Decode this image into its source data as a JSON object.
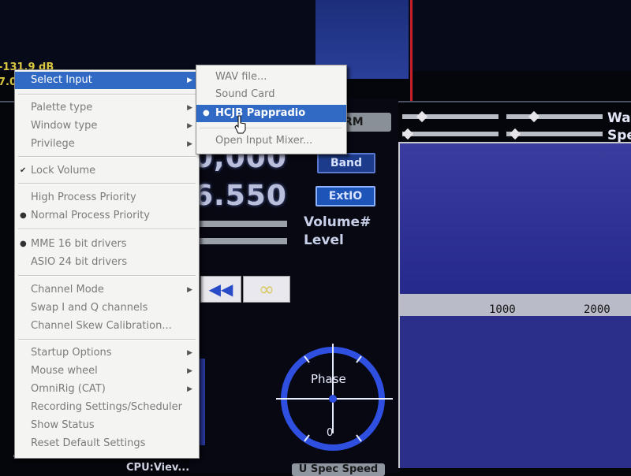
{
  "background": {
    "signal_level": "-131.9 dB",
    "signal_level_fragment": "7.0",
    "frequency_top": "0,000",
    "frequency_bottom": "6.550",
    "band_button": "Band",
    "extio_button": "ExtIO",
    "drm_button": "RM",
    "volume_label": "Volume#",
    "level_label": "Level",
    "rewind_icon": "◀◀",
    "loop_icon": "∞",
    "phase_label": "Phase",
    "phase_zero": "0",
    "spec_speed_button": "U Spec Speed",
    "cpu_text": "CPU:Viev...",
    "timestamp_text": "...",
    "wa_label": "Wa",
    "spe_label": "Spe",
    "ruler_1000": "1000",
    "ruler_2000": "2000"
  },
  "context_menu": {
    "items": [
      {
        "label": "Select Input",
        "has_submenu": true,
        "selected": true
      },
      {
        "label": "Palette type",
        "has_submenu": true
      },
      {
        "label": "Window type",
        "has_submenu": true
      },
      {
        "label": "Privilege",
        "has_submenu": true
      },
      {
        "label": "Lock Volume",
        "checked": true
      },
      {
        "label": "High Process Priority"
      },
      {
        "label": "Normal Process Priority",
        "radio": true
      },
      {
        "label": "MME 16 bit drivers",
        "radio": true
      },
      {
        "label": "ASIO   24 bit drivers"
      },
      {
        "label": "Channel Mode",
        "has_submenu": true
      },
      {
        "label": "Swap I and Q channels"
      },
      {
        "label": "Channel Skew Calibration..."
      },
      {
        "label": "Startup Options",
        "has_submenu": true
      },
      {
        "label": "Mouse wheel",
        "has_submenu": true
      },
      {
        "label": "OmniRig (CAT)",
        "has_submenu": true
      },
      {
        "label": "Recording Settings/Scheduler"
      },
      {
        "label": "Show Status"
      },
      {
        "label": "Reset Default Settings"
      }
    ],
    "check_mark": "✔",
    "radio_mark": "●",
    "submenu_arrow": "▶"
  },
  "submenu": {
    "items": [
      {
        "label": "WAV file..."
      },
      {
        "label": "Sound Card"
      },
      {
        "label": "HCJB Pappradio",
        "radio": true,
        "selected": true
      },
      {
        "label": "Open Input Mixer..."
      }
    ]
  },
  "colors": {
    "menu_highlight": "#316ac5",
    "signal_yellow": "#d9c640",
    "marker_red": "#c8202a"
  }
}
